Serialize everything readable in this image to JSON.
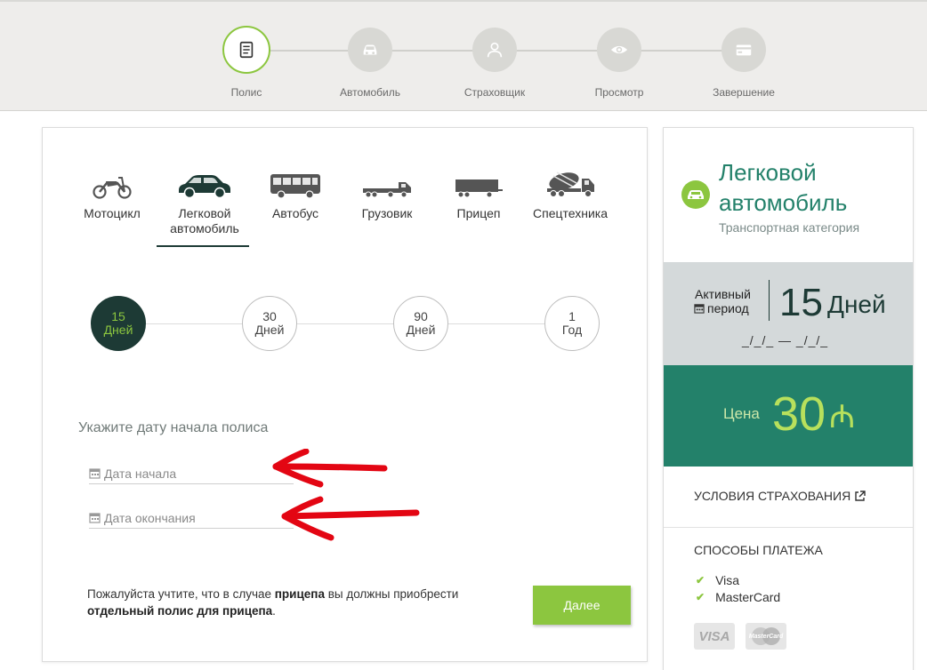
{
  "stepper": {
    "steps": [
      {
        "label": "Полис",
        "icon": "document-icon",
        "active": true
      },
      {
        "label": "Автомобиль",
        "icon": "car-icon",
        "active": false
      },
      {
        "label": "Страховщик",
        "icon": "person-icon",
        "active": false
      },
      {
        "label": "Просмотр",
        "icon": "eye-icon",
        "active": false
      },
      {
        "label": "Завершение",
        "icon": "credit-card-icon",
        "active": false
      }
    ]
  },
  "vehicles": [
    {
      "label": "Мотоцикл",
      "icon": "motorcycle-icon"
    },
    {
      "label": "Легковой автомобиль",
      "icon": "car-icon",
      "active": true
    },
    {
      "label": "Автобус",
      "icon": "bus-icon"
    },
    {
      "label": "Грузовик",
      "icon": "truck-icon"
    },
    {
      "label": "Прицеп",
      "icon": "trailer-icon"
    },
    {
      "label": "Спецтехника",
      "icon": "concrete-mixer-icon"
    }
  ],
  "periods": [
    {
      "value": "15",
      "unit": "Дней",
      "active": true
    },
    {
      "value": "30",
      "unit": "Дней"
    },
    {
      "value": "90",
      "unit": "Дней"
    },
    {
      "value": "1",
      "unit": "Год"
    }
  ],
  "form": {
    "title": "Укажите дату начала полиса",
    "start_placeholder": "Дата начала",
    "end_placeholder": "Дата окончания"
  },
  "note": {
    "part1": "Пожалуйста учтите, что в случае ",
    "bold1": "прицепа",
    "part2": " вы должны приобрести ",
    "bold2": "отдельный полис для прицепа",
    "part3": "."
  },
  "next_button": "Далее",
  "summary": {
    "category_title": "Легковой автомобиль",
    "category_subtitle": "Транспортная категория",
    "active_label_1": "Активный",
    "active_label_2": "период",
    "active_value": "15",
    "active_unit": "Дней",
    "active_dates": "_/_/_ — _/_/_",
    "price_label": "Цена",
    "price_value": "30",
    "currency": "₼",
    "terms_link": "УСЛОВИЯ СТРАХОВАНИЯ",
    "payment_title": "СПОСОБЫ ПЛАТЕЖА",
    "payment_methods": [
      "Visa",
      "MasterCard"
    ],
    "card_logos": [
      "VISA",
      "MasterCard"
    ]
  },
  "colors": {
    "accent_green": "#8cc63f",
    "dark_green": "#1d3a35",
    "teal": "#23816a",
    "arrow_red": "#e30613"
  }
}
